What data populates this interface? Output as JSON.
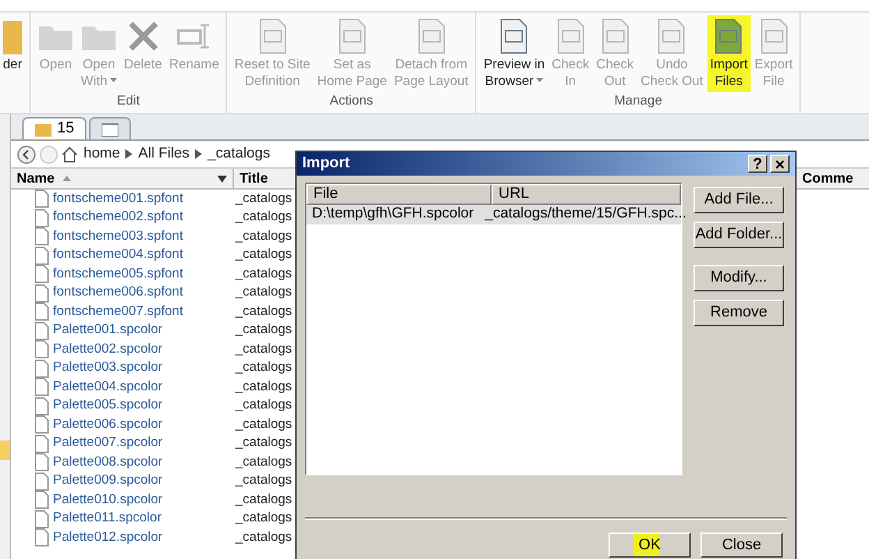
{
  "ribbon": {
    "groups": [
      {
        "buttons": [
          {
            "lines": [
              "der"
            ],
            "disabled": false,
            "dropdown": false,
            "highlighted": false
          }
        ]
      },
      {
        "label": "Edit",
        "buttons": [
          {
            "lines": [
              "Open"
            ],
            "disabled": true,
            "dropdown": false,
            "highlighted": false
          },
          {
            "lines": [
              "Open",
              "With"
            ],
            "disabled": true,
            "dropdown": true,
            "highlighted": false
          },
          {
            "lines": [
              "Delete"
            ],
            "disabled": true,
            "dropdown": false,
            "highlighted": false
          },
          {
            "lines": [
              "Rename"
            ],
            "disabled": true,
            "dropdown": false,
            "highlighted": false
          }
        ]
      },
      {
        "label": "Actions",
        "buttons": [
          {
            "lines": [
              "Reset to Site",
              "Definition"
            ],
            "disabled": true,
            "dropdown": false,
            "highlighted": false
          },
          {
            "lines": [
              "Set as",
              "Home Page"
            ],
            "disabled": true,
            "dropdown": false,
            "highlighted": false
          },
          {
            "lines": [
              "Detach from",
              "Page Layout"
            ],
            "disabled": true,
            "dropdown": false,
            "highlighted": false
          }
        ]
      },
      {
        "label": "Manage",
        "buttons": [
          {
            "lines": [
              "Preview in",
              "Browser"
            ],
            "disabled": false,
            "dropdown": true,
            "highlighted": false
          },
          {
            "lines": [
              "Check",
              "In"
            ],
            "disabled": true,
            "dropdown": false,
            "highlighted": false
          },
          {
            "lines": [
              "Check",
              "Out"
            ],
            "disabled": true,
            "dropdown": false,
            "highlighted": false
          },
          {
            "lines": [
              "Undo",
              "Check Out"
            ],
            "disabled": true,
            "dropdown": false,
            "highlighted": false
          },
          {
            "lines": [
              "Import",
              "Files"
            ],
            "disabled": false,
            "dropdown": false,
            "highlighted": true
          },
          {
            "lines": [
              "Export",
              "File"
            ],
            "disabled": true,
            "dropdown": false,
            "highlighted": false
          }
        ]
      }
    ]
  },
  "tabs": [
    {
      "label": "15",
      "selected": true
    },
    {
      "selected": false
    }
  ],
  "breadcrumb": [
    "home",
    "All Files",
    "_catalogs"
  ],
  "file_list": {
    "columns": [
      "Name",
      "Title",
      "Comme"
    ],
    "rows": [
      {
        "name": "fontscheme001.spfont",
        "title": "_catalogs"
      },
      {
        "name": "fontscheme002.spfont",
        "title": "_catalogs"
      },
      {
        "name": "fontscheme003.spfont",
        "title": "_catalogs"
      },
      {
        "name": "fontscheme004.spfont",
        "title": "_catalogs"
      },
      {
        "name": "fontscheme005.spfont",
        "title": "_catalogs"
      },
      {
        "name": "fontscheme006.spfont",
        "title": "_catalogs"
      },
      {
        "name": "fontscheme007.spfont",
        "title": "_catalogs"
      },
      {
        "name": "Palette001.spcolor",
        "title": "_catalogs"
      },
      {
        "name": "Palette002.spcolor",
        "title": "_catalogs"
      },
      {
        "name": "Palette003.spcolor",
        "title": "_catalogs"
      },
      {
        "name": "Palette004.spcolor",
        "title": "_catalogs"
      },
      {
        "name": "Palette005.spcolor",
        "title": "_catalogs"
      },
      {
        "name": "Palette006.spcolor",
        "title": "_catalogs"
      },
      {
        "name": "Palette007.spcolor",
        "title": "_catalogs"
      },
      {
        "name": "Palette008.spcolor",
        "title": "_catalogs"
      },
      {
        "name": "Palette009.spcolor",
        "title": "_catalogs"
      },
      {
        "name": "Palette010.spcolor",
        "title": "_catalogs"
      },
      {
        "name": "Palette011.spcolor",
        "title": "_catalogs"
      },
      {
        "name": "Palette012.spcolor",
        "title": "_catalogs"
      }
    ]
  },
  "dialog": {
    "title": "Import",
    "help": "?",
    "close": "×",
    "columns": [
      "File",
      "URL"
    ],
    "rows": [
      {
        "file": "D:\\temp\\gfh\\GFH.spcolor",
        "url": "_catalogs/theme/15/GFH.spc...",
        "selected": true
      }
    ],
    "side_buttons": [
      "Add File...",
      "Add Folder...",
      "Modify...",
      "Remove"
    ],
    "footer_buttons": [
      {
        "label": "OK",
        "highlighted": true
      },
      {
        "label": "Close",
        "highlighted": false
      }
    ]
  }
}
